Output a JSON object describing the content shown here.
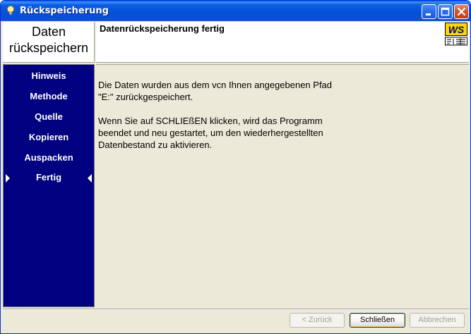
{
  "window": {
    "title": "Rückspeicherung"
  },
  "header": {
    "left_line1": "Daten",
    "left_line2": "rückspeichern",
    "title": "Datenrückspeicherung fertig",
    "logo_text": "WS"
  },
  "sidebar": {
    "items": [
      {
        "label": "Hinweis"
      },
      {
        "label": "Methode"
      },
      {
        "label": "Quelle"
      },
      {
        "label": "Kopieren"
      },
      {
        "label": "Auspacken"
      },
      {
        "label": "Fertig",
        "selected": true
      }
    ]
  },
  "content": {
    "para1_line1": "Die Daten wurden aus dem vcn Ihnen angegebenen Pfad",
    "para1_line2": "\"E:\" zurückgespeichert.",
    "para2_line1": "Wenn Sie auf SCHLIEßEN klicken, wird das Programm",
    "para2_line2": "beendet und neu gestartet, um den wiederhergestellten",
    "para2_line3": "Datenbestand zu aktivieren."
  },
  "footer": {
    "back_label": "< Zurück",
    "close_label": "Schließen",
    "cancel_label": "Abbrechen"
  },
  "colors": {
    "sidebar_bg": "#000080",
    "titlebar_blue": "#0552d9",
    "logo_yellow": "#ffd700"
  }
}
